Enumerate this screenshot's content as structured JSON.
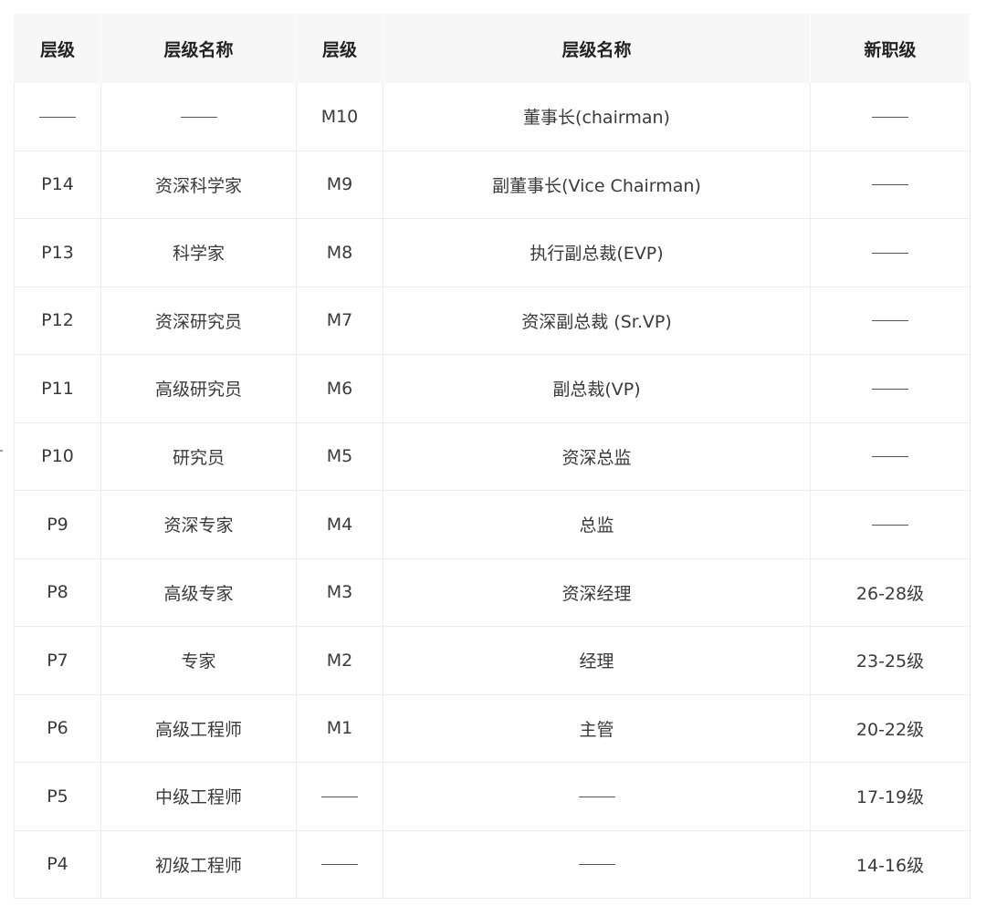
{
  "headers": [
    "层级",
    "层级名称",
    "层级",
    "层级名称",
    "新职级"
  ],
  "rows": [
    [
      "——",
      "——",
      "M10",
      "董事长(chairman)",
      "——"
    ],
    [
      "P14",
      "资深科学家",
      "M9",
      "副董事长(Vice Chairman)",
      "——"
    ],
    [
      "P13",
      "科学家",
      "M8",
      "执行副总裁(EVP)",
      "——"
    ],
    [
      "P12",
      "资深研究员",
      "M7",
      "资深副总裁 (Sr.VP)",
      "——"
    ],
    [
      "P11",
      "高级研究员",
      "M6",
      "副总裁(VP)",
      "——"
    ],
    [
      "P10",
      "研究员",
      "M5",
      "资深总监",
      "——"
    ],
    [
      "P9",
      "资深专家",
      "M4",
      "总监",
      "——"
    ],
    [
      "P8",
      "高级专家",
      "M3",
      "资深经理",
      "26-28级"
    ],
    [
      "P7",
      "专家",
      "M2",
      "经理",
      "23-25级"
    ],
    [
      "P6",
      "高级工程师",
      "M1",
      "主管",
      "20-22级"
    ],
    [
      "P5",
      "中级工程师",
      "——",
      "——",
      "17-19级"
    ],
    [
      "P4",
      "初级工程师",
      "——",
      "——",
      "14-16级"
    ]
  ]
}
